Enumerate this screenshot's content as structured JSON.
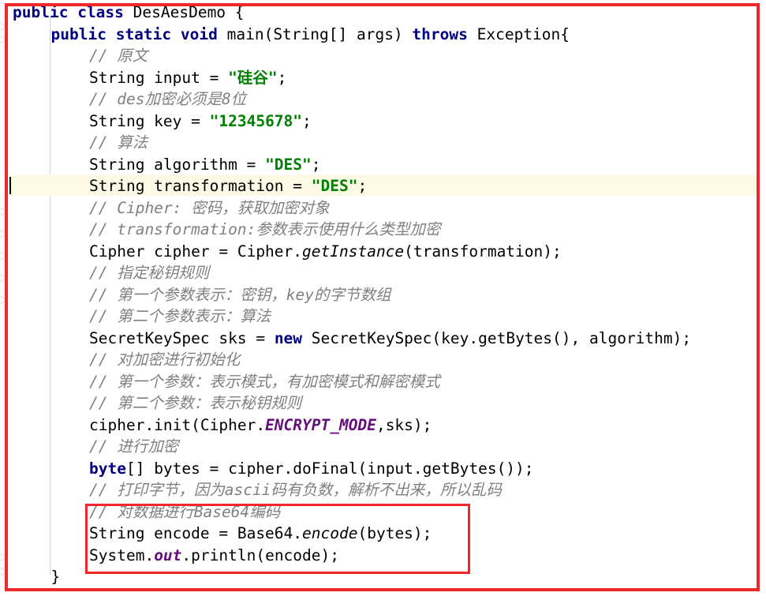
{
  "editor": {
    "language": "java",
    "class_name": "DesAesDemo",
    "current_line_number": 8,
    "colors": {
      "background": "#ffffff",
      "keyword": "#000080",
      "string": "#008000",
      "comment": "#808080",
      "static_field": "#660e7a",
      "plain_text": "#000000",
      "current_line_highlight": "#fcfae4",
      "annotation_box": "#ef2929",
      "indent_guide": "#d4d4d4"
    }
  },
  "annotations": {
    "outer_box_label": "whole-code-highlight",
    "inner_box_label": "base64-encode-highlight"
  },
  "code": {
    "lines": [
      {
        "indent": 0,
        "tokens": [
          {
            "t": "kw",
            "v": "public"
          },
          {
            "t": "plain",
            "v": " "
          },
          {
            "t": "kw",
            "v": "class"
          },
          {
            "t": "plain",
            "v": " DesAesDemo {"
          }
        ]
      },
      {
        "indent": 1,
        "tokens": [
          {
            "t": "kw",
            "v": "public"
          },
          {
            "t": "plain",
            "v": " "
          },
          {
            "t": "kw",
            "v": "static"
          },
          {
            "t": "plain",
            "v": " "
          },
          {
            "t": "kw",
            "v": "void"
          },
          {
            "t": "plain",
            "v": " main(String[] args) "
          },
          {
            "t": "kw",
            "v": "throws"
          },
          {
            "t": "plain",
            "v": " Exception{"
          }
        ]
      },
      {
        "indent": 2,
        "tokens": [
          {
            "t": "cmt",
            "v": "// 原文"
          }
        ]
      },
      {
        "indent": 2,
        "tokens": [
          {
            "t": "plain",
            "v": "String input = "
          },
          {
            "t": "str",
            "v": "\"硅谷\""
          },
          {
            "t": "plain",
            "v": ";"
          }
        ]
      },
      {
        "indent": 2,
        "tokens": [
          {
            "t": "cmt",
            "v": "// des加密必须是8位"
          }
        ]
      },
      {
        "indent": 2,
        "tokens": [
          {
            "t": "plain",
            "v": "String key = "
          },
          {
            "t": "str",
            "v": "\"12345678\""
          },
          {
            "t": "plain",
            "v": ";"
          }
        ]
      },
      {
        "indent": 2,
        "tokens": [
          {
            "t": "cmt",
            "v": "// 算法"
          }
        ]
      },
      {
        "indent": 2,
        "tokens": [
          {
            "t": "plain",
            "v": "String algorithm = "
          },
          {
            "t": "str",
            "v": "\"DES\""
          },
          {
            "t": "plain",
            "v": ";"
          }
        ]
      },
      {
        "indent": 2,
        "current": true,
        "tokens": [
          {
            "t": "plain",
            "v": "String transformation = "
          },
          {
            "t": "str",
            "v": "\"DES\""
          },
          {
            "t": "plain",
            "v": ";"
          }
        ]
      },
      {
        "indent": 2,
        "tokens": [
          {
            "t": "cmt",
            "v": "// Cipher: 密码，获取加密对象"
          }
        ]
      },
      {
        "indent": 2,
        "tokens": [
          {
            "t": "cmt",
            "v": "// transformation:参数表示使用什么类型加密"
          }
        ]
      },
      {
        "indent": 2,
        "tokens": [
          {
            "t": "plain",
            "v": "Cipher cipher = Cipher."
          },
          {
            "t": "method",
            "v": "getInstance"
          },
          {
            "t": "plain",
            "v": "(transformation);"
          }
        ]
      },
      {
        "indent": 2,
        "tokens": [
          {
            "t": "cmt",
            "v": "// 指定秘钥规则"
          }
        ]
      },
      {
        "indent": 2,
        "tokens": [
          {
            "t": "cmt",
            "v": "// 第一个参数表示：密钥，key的字节数组"
          }
        ]
      },
      {
        "indent": 2,
        "tokens": [
          {
            "t": "cmt",
            "v": "// 第二个参数表示：算法"
          }
        ]
      },
      {
        "indent": 2,
        "tokens": [
          {
            "t": "plain",
            "v": "SecretKeySpec sks = "
          },
          {
            "t": "kw",
            "v": "new"
          },
          {
            "t": "plain",
            "v": " SecretKeySpec(key.getBytes(), algorithm);"
          }
        ]
      },
      {
        "indent": 2,
        "tokens": [
          {
            "t": "cmt",
            "v": "// 对加密进行初始化"
          }
        ]
      },
      {
        "indent": 2,
        "tokens": [
          {
            "t": "cmt",
            "v": "// 第一个参数：表示模式，有加密模式和解密模式"
          }
        ]
      },
      {
        "indent": 2,
        "tokens": [
          {
            "t": "cmt",
            "v": "// 第二个参数：表示秘钥规则"
          }
        ]
      },
      {
        "indent": 2,
        "tokens": [
          {
            "t": "plain",
            "v": "cipher.init(Cipher."
          },
          {
            "t": "sfield",
            "v": "ENCRYPT_MODE"
          },
          {
            "t": "plain",
            "v": ",sks);"
          }
        ]
      },
      {
        "indent": 2,
        "tokens": [
          {
            "t": "cmt",
            "v": "// 进行加密"
          }
        ]
      },
      {
        "indent": 2,
        "tokens": [
          {
            "t": "kw",
            "v": "byte"
          },
          {
            "t": "plain",
            "v": "[] bytes = cipher.doFinal(input.getBytes());"
          }
        ]
      },
      {
        "indent": 2,
        "tokens": [
          {
            "t": "cmt",
            "v": "// 打印字节，因为ascii码有负数，解析不出来，所以乱码"
          }
        ]
      },
      {
        "indent": 2,
        "tokens": [
          {
            "t": "cmt",
            "v": "// 对数据进行Base64编码"
          }
        ]
      },
      {
        "indent": 2,
        "tokens": [
          {
            "t": "plain",
            "v": "String encode = Base64."
          },
          {
            "t": "method",
            "v": "encode"
          },
          {
            "t": "plain",
            "v": "(bytes);"
          }
        ]
      },
      {
        "indent": 2,
        "tokens": [
          {
            "t": "plain",
            "v": "System."
          },
          {
            "t": "sfield",
            "v": "out"
          },
          {
            "t": "plain",
            "v": ".println(encode);"
          }
        ]
      },
      {
        "indent": 1,
        "tokens": [
          {
            "t": "plain",
            "v": "}"
          }
        ]
      }
    ]
  }
}
